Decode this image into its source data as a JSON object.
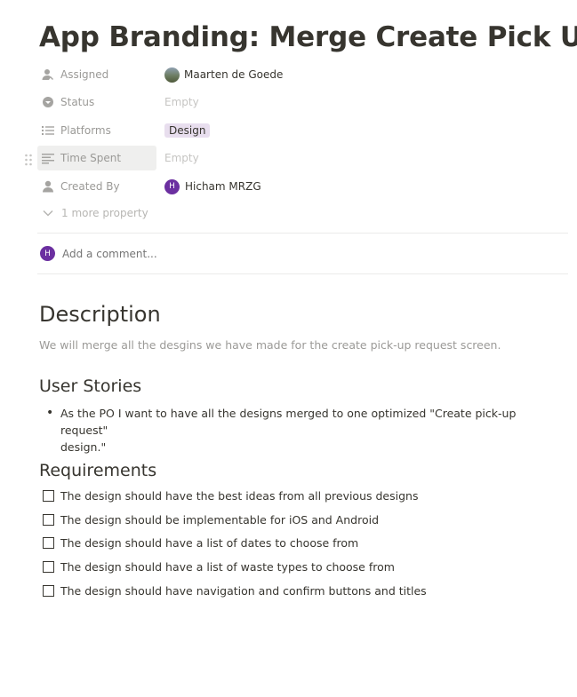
{
  "page": {
    "title": "App Branding: Merge Create Pick Up"
  },
  "properties": {
    "assigned": {
      "label": "Assigned",
      "icon": "person-icon",
      "value": "Maarten de Goede"
    },
    "status": {
      "label": "Status",
      "icon": "status-icon",
      "value": "Empty"
    },
    "platforms": {
      "label": "Platforms",
      "icon": "list-icon",
      "value": "Design",
      "tag_color": "#e8deee"
    },
    "time_spent": {
      "label": "Time Spent",
      "icon": "text-icon",
      "value": "Empty"
    },
    "created_by": {
      "label": "Created By",
      "icon": "person-icon",
      "value": "Hicham MRZG",
      "avatar_letter": "H",
      "avatar_color": "#6b2fa0"
    },
    "more": "1 more property"
  },
  "comment": {
    "avatar_letter": "H",
    "placeholder": "Add a comment..."
  },
  "content": {
    "description_heading": "Description",
    "description_text": "We will merge all the desgins we have made for the create pick-up request screen.",
    "user_stories_heading": "User Stories",
    "user_story_line1": "As the PO I want to have all the designs merged to one optimized \"Create pick-up request\"",
    "user_story_line2": "design.\"",
    "requirements_heading": "Requirements",
    "requirements": [
      "The design should have the best ideas from all previous designs",
      "The design should be implementable for iOS and Android",
      "The design should have a list of dates to choose from",
      "The design should have a list of waste types to choose from",
      "The design should have navigation and confirm buttons and titles"
    ]
  },
  "colors": {
    "text": "#37352f",
    "muted": "#9b9a97",
    "accent_purple": "#6b2fa0"
  }
}
